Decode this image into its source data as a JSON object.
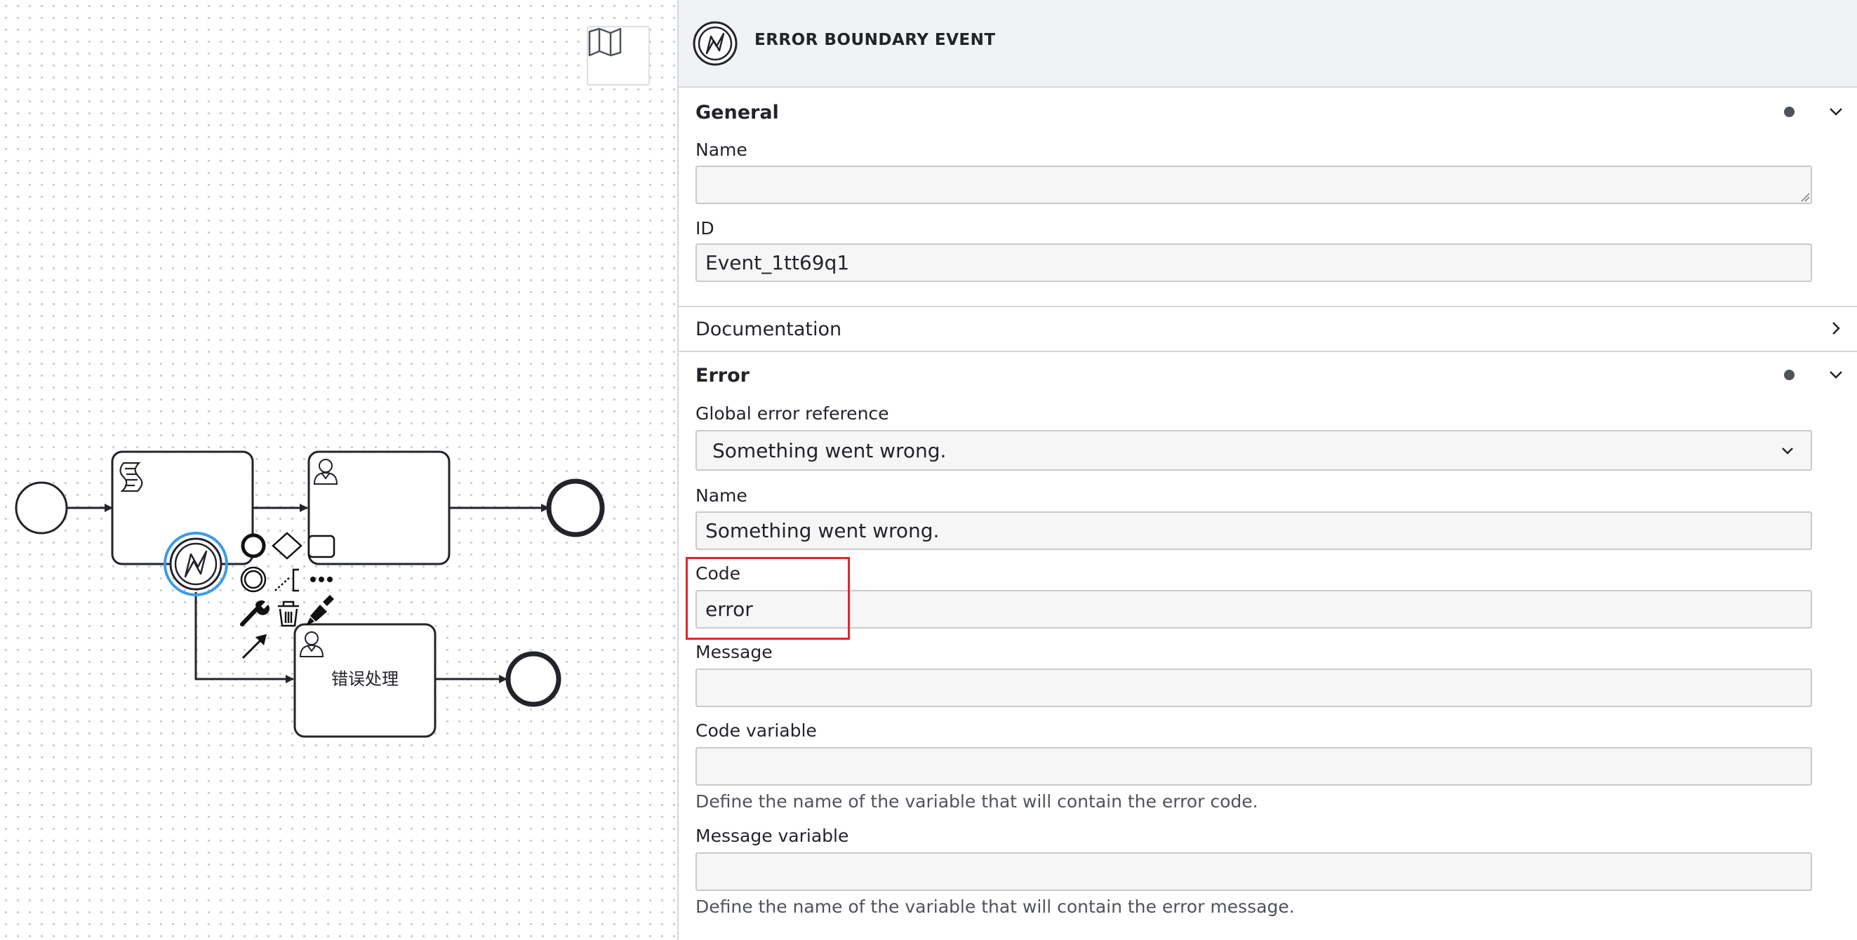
{
  "canvas": {
    "task_label": "错误处理",
    "context_pad_icons": [
      "end-event-icon",
      "gateway-icon",
      "task-icon",
      "intermediate-event-icon",
      "text-annotation-icon",
      "more-icon",
      "wrench-icon",
      "trash-icon",
      "paint-bucket-icon",
      "connect-arrow-icon"
    ],
    "minimap_icon": "map-icon"
  },
  "panel": {
    "header": {
      "icon": "error-event-icon",
      "title": "ERROR BOUNDARY EVENT"
    },
    "general": {
      "title": "General",
      "name_label": "Name",
      "name_value": "",
      "id_label": "ID",
      "id_value": "Event_1tt69q1"
    },
    "documentation": {
      "title": "Documentation"
    },
    "error": {
      "title": "Error",
      "global_ref_label": "Global error reference",
      "global_ref_value": "Something went wrong.",
      "name_label": "Name",
      "name_value": "Something went wrong.",
      "code_label": "Code",
      "code_value": "error",
      "message_label": "Message",
      "message_value": "",
      "code_variable_label": "Code variable",
      "code_variable_value": "",
      "code_variable_hint": "Define the name of the variable that will contain the error code.",
      "message_variable_label": "Message variable",
      "message_variable_value": "",
      "message_variable_hint": "Define the name of the variable that will contain the error message."
    }
  },
  "colors": {
    "selection": "#3d9be9",
    "highlight": "#e0262b",
    "stroke": "#22242a"
  }
}
